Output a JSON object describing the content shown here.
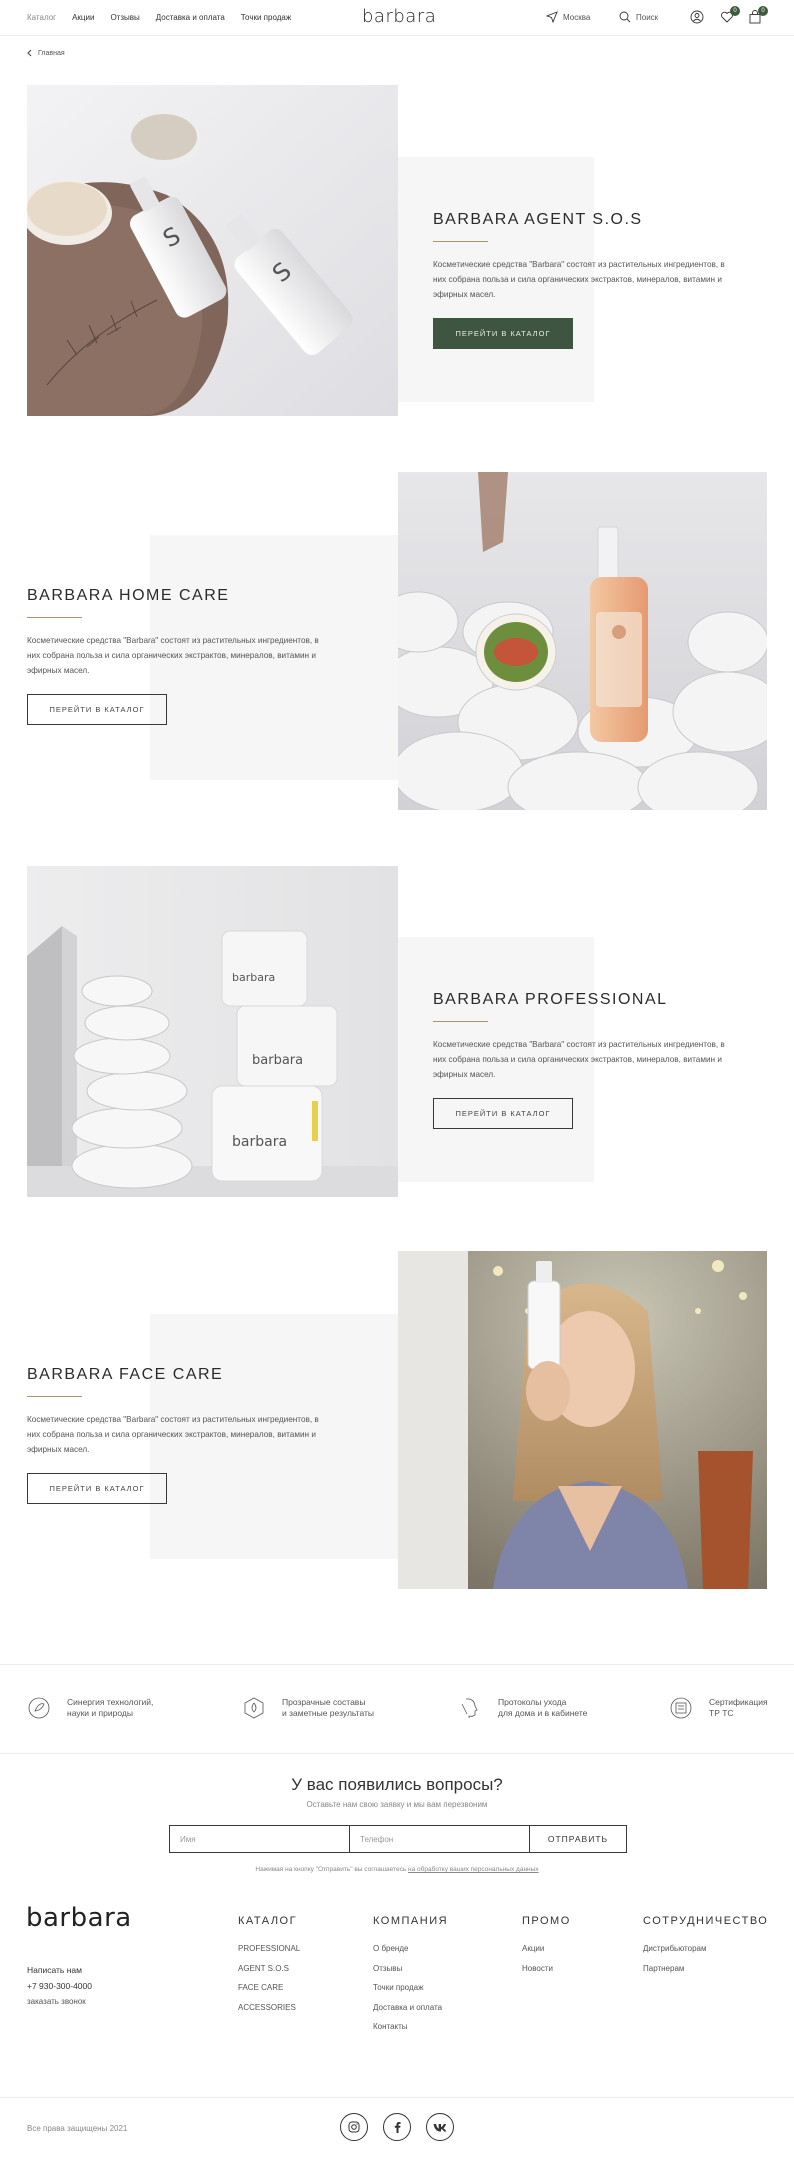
{
  "header": {
    "nav": [
      "Каталог",
      "Акции",
      "Отзывы",
      "Доставка и оплата",
      "Точки продаж"
    ],
    "logo": "barbara",
    "city": "Москва",
    "search_label": "Поиск",
    "favorites_count": "0",
    "cart_count": "0"
  },
  "breadcrumb": {
    "home": "Главная"
  },
  "collections": [
    {
      "title": "BARBARA AGENT S.O.S",
      "description": "Косметические средства \"Barbara\" состоят из растительных ингредиентов, в них собрана польза и сила органических экстрактов, минералов, витамин и эфирных масел.",
      "button": "ПЕРЕЙТИ В КАТАЛОГ"
    },
    {
      "title": "BARBARA HOME CARE",
      "description": "Косметические средства \"Barbara\" состоят из растительных ингредиентов, в них собрана польза и сила органических экстрактов, минералов, витамин и эфирных масел.",
      "button": "ПЕРЕЙТИ В КАТАЛОГ"
    },
    {
      "title": "BARBARA PROFESSIONAL",
      "description": "Косметические средства \"Barbara\" состоят из растительных ингредиентов, в них собрана польза и сила органических экстрактов, минералов, витамин и эфирных масел.",
      "button": "ПЕРЕЙТИ В КАТАЛОГ"
    },
    {
      "title": "BARBARA FACE CARE",
      "description": "Косметические средства \"Barbara\" состоят из растительных ингредиентов, в них собрана польза и сила органических экстрактов, минералов, витамин и эфирных масел.",
      "button": "ПЕРЕЙТИ В КАТАЛОГ"
    }
  ],
  "features": [
    {
      "line1": "Синергия технологий,",
      "line2": "науки и природы"
    },
    {
      "line1": "Прозрачные составы",
      "line2": "и заметные результаты"
    },
    {
      "line1": "Протоколы ухода",
      "line2": "для дома и в кабинете"
    },
    {
      "line1": "Сертификация",
      "line2": "ТР ТС"
    }
  ],
  "contact_form": {
    "title": "У вас появились вопросы?",
    "subtitle": "Оставьте нам свою заявку и мы вам перезвоним",
    "name_placeholder": "Имя",
    "phone_placeholder": "Телефон",
    "submit": "ОТПРАВИТЬ",
    "consent_text": "Нажимая на кнопку \"Отправить\" вы соглашаетесь",
    "consent_link": "на обработку ваших персональных данных"
  },
  "footer": {
    "logo": "barbara",
    "write_us": "Написать нам",
    "phone": "+7 930-300-4000",
    "callback": "заказать звонок",
    "columns": [
      {
        "heading": "КАТАЛОГ",
        "items": [
          "PROFESSIONAL",
          "AGENT S.O.S",
          "FACE CARE",
          "ACCESSORIES"
        ]
      },
      {
        "heading": "КОМПАНИЯ",
        "items": [
          "О бренде",
          "Отзывы",
          "Точки продаж",
          "Доставка и оплата",
          "Контакты"
        ]
      },
      {
        "heading": "ПРОМО",
        "items": [
          "Акции",
          "Новости"
        ]
      },
      {
        "heading": "СОТРУДНИЧЕСТВО",
        "items": [
          "Дистрибьюторам",
          "Партнерам"
        ]
      }
    ],
    "copyright": "Все права защищены 2021",
    "social": [
      "instagram-icon",
      "facebook-icon",
      "vk-icon"
    ]
  },
  "colors": {
    "accent_green": "#3e5641",
    "gold_line": "#a69866",
    "panel_grey": "#f6f6f6"
  }
}
